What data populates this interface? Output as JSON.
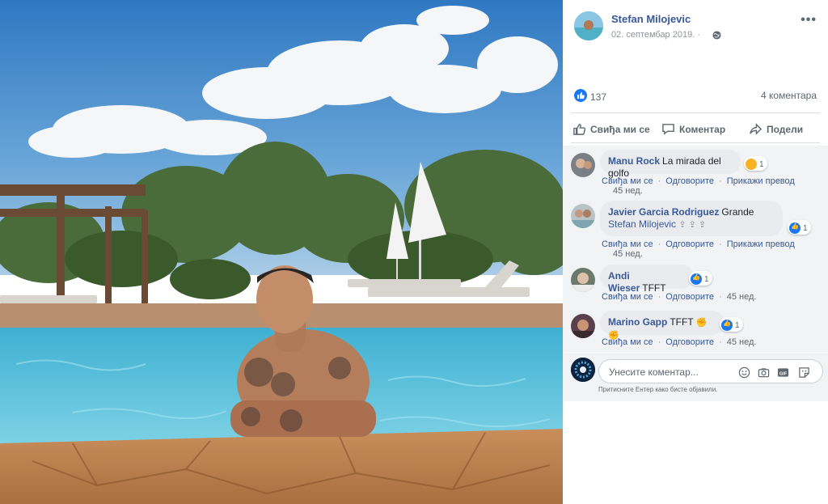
{
  "post": {
    "author": "Stefan Milojevic",
    "date": "02. септембар 2019. ·",
    "more_label": "•••"
  },
  "stats": {
    "likes": "137",
    "comments": "4 коментара"
  },
  "actions": {
    "like": "Свиђа ми се",
    "comment": "Коментар",
    "share": "Подели"
  },
  "comments": [
    {
      "author": "Manu Rock",
      "text": "La mirada del golfo",
      "reaction_count": "1",
      "like": "Свиђа ми се",
      "reply": "Одговорите",
      "translate": "Прикажи превод",
      "time": "45 нед."
    },
    {
      "author": "Javier Garcia Rodriguez",
      "text": "Grande",
      "mention": "Stefan Milojevic",
      "reaction_count": "1",
      "like": "Свиђа ми се",
      "reply": "Одговорите",
      "translate": "Прикажи превод",
      "time": "45 нед."
    },
    {
      "author": "Andi Wieser",
      "text": "TFFT",
      "reaction_count": "1",
      "like": "Свиђа ми се",
      "reply": "Одговорите",
      "time": "45 нед."
    },
    {
      "author": "Marino Gapp",
      "text": "TFFT",
      "reaction_count": "1",
      "like": "Свиђа ми се",
      "reply": "Одговорите",
      "time": "45 нед."
    }
  ],
  "composer": {
    "placeholder": "Унесите коментар...",
    "hint": "Притисните Ентер како бисте објавили."
  },
  "icons": {
    "like": "thumbs-up-icon",
    "comment": "speech-bubble-icon",
    "share": "share-arrow-icon",
    "privacy": "globe-icon",
    "emoji": "smiley-icon",
    "camera": "camera-icon",
    "gif": "gif-icon",
    "sticker": "sticker-icon"
  },
  "colors": {
    "link": "#385898",
    "like_blue": "#1877f2",
    "comments_bg": "#f2f3f5"
  }
}
